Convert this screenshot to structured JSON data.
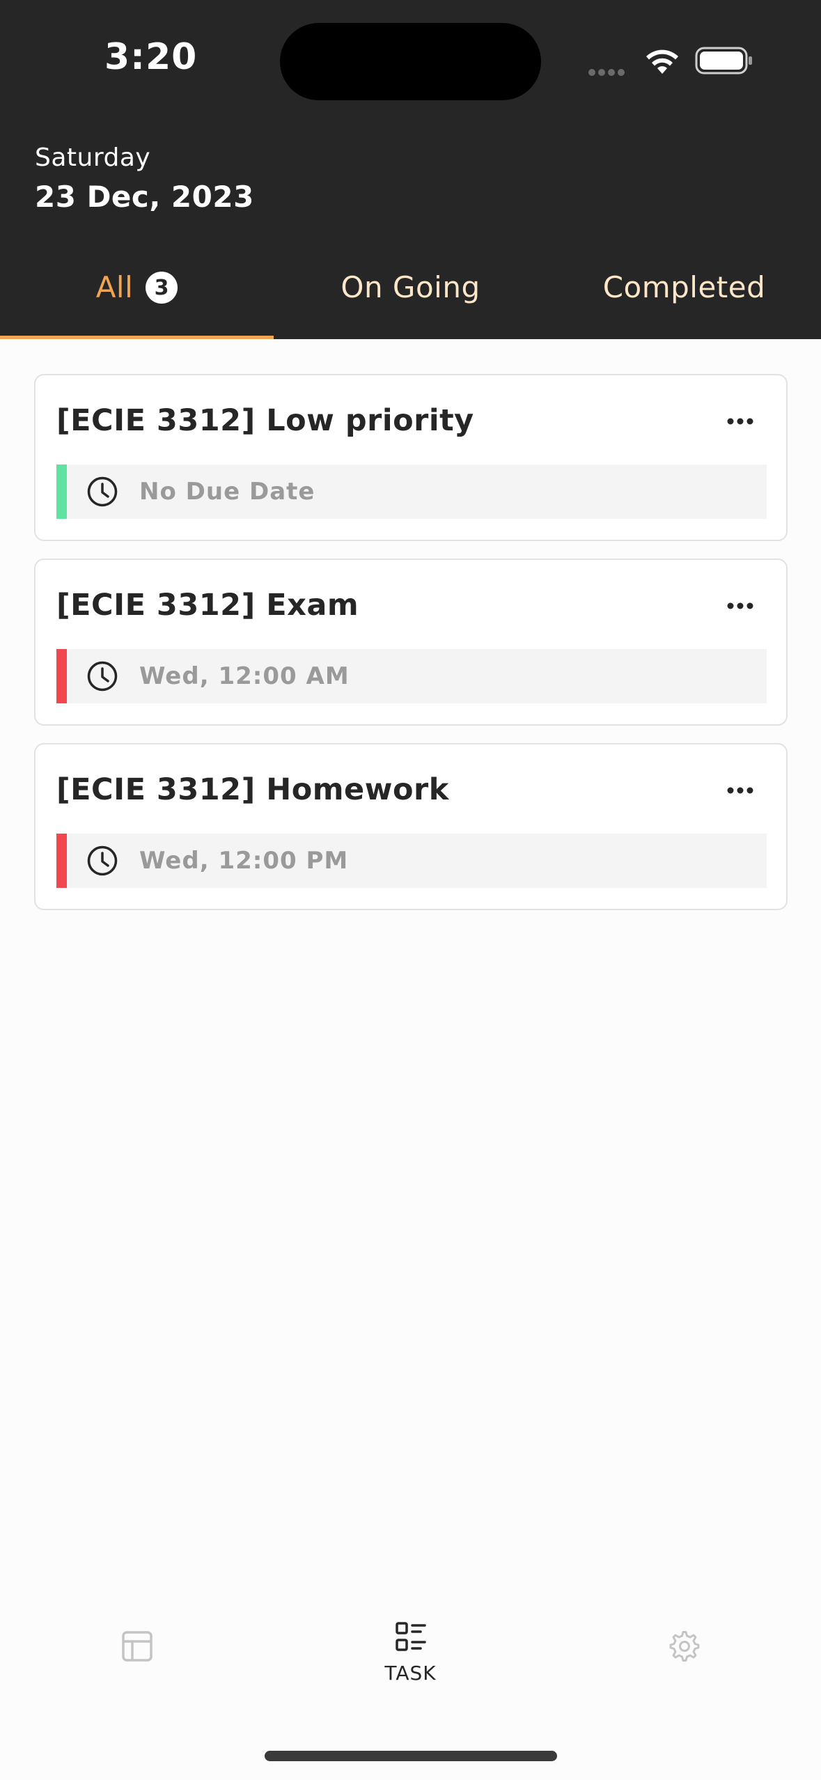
{
  "status_bar": {
    "time": "3:20"
  },
  "header": {
    "day": "Saturday",
    "date": "23 Dec, 2023"
  },
  "tabs": [
    {
      "label": "All",
      "badge": "3",
      "active": true
    },
    {
      "label": "On Going",
      "active": false
    },
    {
      "label": "Completed",
      "active": false
    }
  ],
  "tasks": [
    {
      "title": "[ECIE 3312] Low priority",
      "due": "No Due Date",
      "priority_color": "#5fe3a1"
    },
    {
      "title": "[ECIE 3312] Exam",
      "due": "Wed, 12:00 AM",
      "priority_color": "#f0484e"
    },
    {
      "title": "[ECIE 3312] Homework",
      "due": "Wed, 12:00 PM",
      "priority_color": "#f0484e"
    }
  ],
  "bottom_nav": {
    "items": [
      {
        "icon": "board-icon",
        "label": ""
      },
      {
        "icon": "task-list-icon",
        "label": "TASK",
        "active": true
      },
      {
        "icon": "gear-icon",
        "label": ""
      }
    ]
  },
  "colors": {
    "header_bg": "#262626",
    "accent": "#f0a552",
    "tab_inactive": "#fbe6c9"
  }
}
